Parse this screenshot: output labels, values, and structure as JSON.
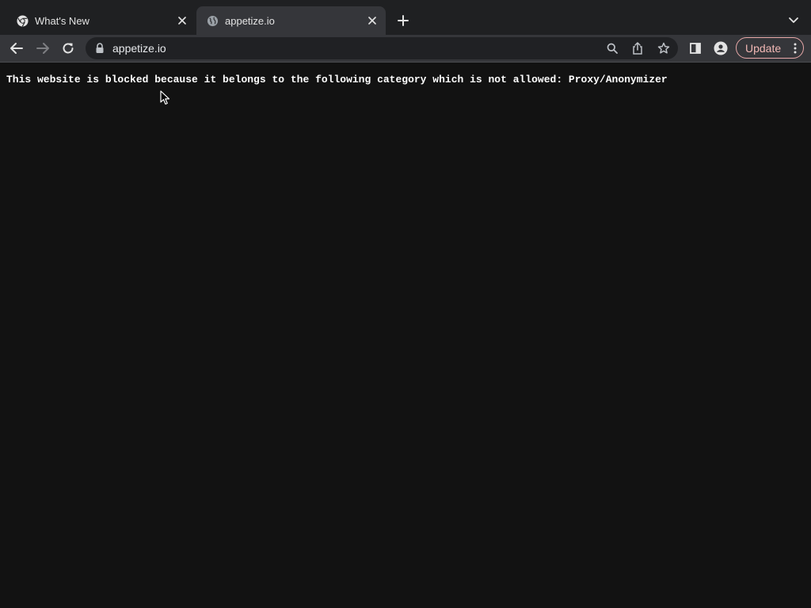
{
  "tabs": [
    {
      "title": "What's New",
      "icon": "chrome-icon",
      "active": false
    },
    {
      "title": "appetize.io",
      "icon": "globe-icon",
      "active": true
    }
  ],
  "address_bar": {
    "url": "appetize.io",
    "icon": "lock-icon"
  },
  "toolbar": {
    "update_label": "Update"
  },
  "page": {
    "message": "This website is blocked because it belongs to the following category which is not allowed: Proxy/Anonymizer"
  },
  "colors": {
    "tabstrip": "#1f2022",
    "toolbar": "#35363a",
    "omnibox": "#202124",
    "content_bg": "#121212",
    "update_accent": "#f2b8b5"
  }
}
